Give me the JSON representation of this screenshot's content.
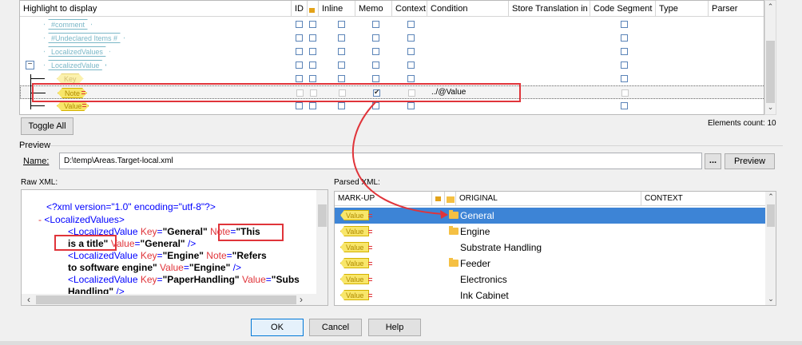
{
  "highlight": {
    "headers": [
      "Highlight to display",
      "ID",
      "",
      "Inline",
      "Memo",
      "Context",
      "Condition",
      "Store Translation in",
      "Code Segment",
      "Type",
      "Parser"
    ],
    "rows": [
      {
        "tag": "#comment",
        "style": "b",
        "condition": ""
      },
      {
        "tag": "#Undeclared Items #",
        "style": "b",
        "condition": ""
      },
      {
        "tag": "LocalizedValues",
        "style": "b",
        "condition": ""
      },
      {
        "tag": "LocalizedValue",
        "style": "b",
        "condition": "",
        "expander": "−"
      },
      {
        "tag": "Key",
        "style": "yf",
        "condition": ""
      },
      {
        "tag": "Note",
        "style": "y",
        "condition": "../@Value"
      },
      {
        "tag": "Value",
        "style": "y",
        "condition": ""
      }
    ],
    "toggle_all_label": "Toggle All",
    "elements_count": "Elements count: 10"
  },
  "preview": {
    "section_label": "Preview",
    "name_label": "Name:",
    "name_value": "D:\\temp\\Areas.Target-local.xml",
    "browse_label": "...",
    "preview_button": "Preview"
  },
  "raw_xml": {
    "label": "Raw XML:",
    "line1": "<?xml version=\"1.0\" encoding=\"utf-8\"?>",
    "line2_dash": "-",
    "line2_tag": "<LocalizedValues>",
    "lv1_open": "<LocalizedValue",
    "lv1_key_attr": "Key",
    "lv1_key_val": "\"General\"",
    "lv1_note_attr": "Note",
    "lv1_note_val1": "\"This",
    "lv1_note_val2": "is a title\"",
    "lv1_value_attr": "Value",
    "lv1_value_val": "\"General\"",
    "lv1_close": "/>",
    "lv2_open": "<LocalizedValue",
    "lv2_key_attr": "Key",
    "lv2_key_val": "\"Engine\"",
    "lv2_note_attr": "Note",
    "lv2_note_val1": "\"Refers",
    "lv2_note_val2": "to software engine\"",
    "lv2_value_attr": "Value",
    "lv2_value_val": "\"Engine\"",
    "lv2_close": "/>",
    "lv3_open": "<LocalizedValue",
    "lv3_key_attr": "Key",
    "lv3_key_val": "\"PaperHandling\"",
    "lv3_value_attr": "Value",
    "lv3_value_val": "\"Subs",
    "lv3_cont": "Handling\"",
    "lv3_close": "/>"
  },
  "parsed_xml": {
    "label": "Parsed XML:",
    "headers": [
      "MARK-UP",
      "",
      "",
      "ORIGINAL",
      "CONTEXT"
    ],
    "rows": [
      {
        "markup": "Value",
        "original": "General",
        "folder": true
      },
      {
        "markup": "Value",
        "original": "Engine",
        "folder": true
      },
      {
        "markup": "Value",
        "original": "Substrate Handling",
        "folder": false
      },
      {
        "markup": "Value",
        "original": "Feeder",
        "folder": true
      },
      {
        "markup": "Value",
        "original": "Electronics",
        "folder": false
      },
      {
        "markup": "Value",
        "original": "Ink Cabinet",
        "folder": false
      }
    ]
  },
  "footer": {
    "ok": "OK",
    "cancel": "Cancel",
    "help": "Help"
  },
  "colors": {
    "annotation_red": "#e0343a",
    "selection_blue": "#3d84d6",
    "tag_blue": "#7ab7c7",
    "tag_yellow": "#f8e66a"
  }
}
